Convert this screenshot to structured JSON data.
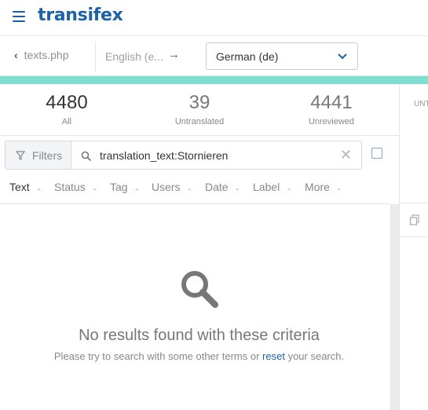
{
  "header": {
    "logo": "transifex"
  },
  "breadcrumb": {
    "back_label": "texts.php",
    "source_lang": "English (e...",
    "target_lang": "German (de)"
  },
  "stats": [
    {
      "value": "4480",
      "label": "All"
    },
    {
      "value": "39",
      "label": "Untranslated"
    },
    {
      "value": "4441",
      "label": "Unreviewed"
    }
  ],
  "side_panel": {
    "tab_label": "UNT"
  },
  "search": {
    "filters_label": "Filters",
    "query": "translation_text:Stornieren",
    "clear_glyph": "✕"
  },
  "filter_tabs": [
    "Text",
    "Status",
    "Tag",
    "Users",
    "Date",
    "Label",
    "More"
  ],
  "empty_state": {
    "title": "No results found with these criteria",
    "sub_before": "Please try to search with some other terms or ",
    "sub_link": "reset",
    "sub_after": " your search."
  },
  "colors": {
    "brand": "#1d62a7",
    "progress": "#7ddfcf"
  }
}
